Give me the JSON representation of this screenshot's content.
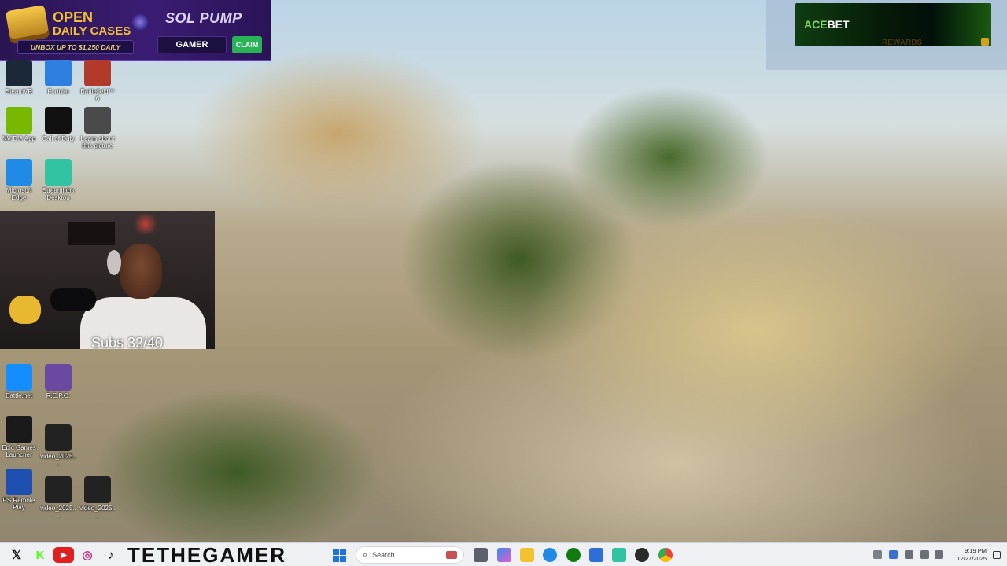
{
  "promo_banner": {
    "line1": "OPEN",
    "line2": "DAILY CASES",
    "unbox_text": "UNBOX UP TO $1,250 DAILY",
    "brand": "SOL PUMP",
    "code": "GAMER",
    "claim_label": "CLAIM"
  },
  "acebet_banner": {
    "brand_prefix": "ACE",
    "brand_suffix": "BET",
    "partial_text": "REWARDS"
  },
  "desktop_icons": [
    {
      "label": "SteamVR",
      "icon": "steamvr-icon",
      "color": "#1b2838"
    },
    {
      "label": "Fortnite",
      "icon": "fortnite-icon",
      "color": "#2f7fe0"
    },
    {
      "label": "Battlefield™ 6",
      "icon": "battlefield-icon",
      "color": "#b23a2a"
    },
    {
      "label": "NVIDIA App",
      "icon": "nvidia-icon",
      "color": "#76b900"
    },
    {
      "label": "Call of Duty",
      "icon": "call-of-duty-icon",
      "color": "#111111"
    },
    {
      "label": "Learn about this picture",
      "icon": "learn-picture-icon",
      "color": "#4a4a4a"
    },
    {
      "label": "Microsoft Edge",
      "icon": "edge-icon",
      "color": "#1f8be6"
    },
    {
      "label": "Streamlabs Desktop",
      "icon": "streamlabs-icon",
      "color": "#31c3a2"
    },
    {
      "label": "Battle.net",
      "icon": "battlenet-icon",
      "color": "#148eff"
    },
    {
      "label": "R.E.P.O.",
      "icon": "repo-icon",
      "color": "#6a4aa0"
    },
    {
      "label": "Epic Games Launcher",
      "icon": "epic-games-icon",
      "color": "#1a1a1a"
    },
    {
      "label": "video_2025...",
      "icon": "video-file-icon",
      "color": "#222222"
    },
    {
      "label": "PS Remote Play",
      "icon": "ps-remote-play-icon",
      "color": "#1f4fb0"
    },
    {
      "label": "video_2025...",
      "icon": "video-file-icon",
      "color": "#222222"
    },
    {
      "label": "video_2025...",
      "icon": "video-file-icon",
      "color": "#222222"
    }
  ],
  "webcam": {
    "subs_text": "Subs 32/40"
  },
  "taskbar": {
    "brand_text": "TETHEGAMER",
    "search_placeholder": "Search",
    "clock_time": "9:19 PM",
    "clock_date": "12/27/2025"
  },
  "colors": {
    "promo_purple": "#3b1c73",
    "claim_green": "#27b356",
    "gold": "#f0c030",
    "taskbar_bg": "#eef0f4",
    "windows_blue": "#1e73e0"
  }
}
